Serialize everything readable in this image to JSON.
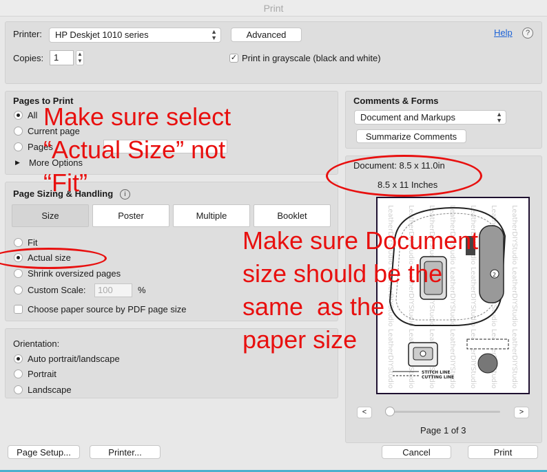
{
  "window": {
    "title": "Print"
  },
  "top": {
    "printer_label": "Printer:",
    "printer_value": "HP Deskjet 1010 series",
    "advanced_label": "Advanced",
    "help_link": "Help",
    "help_icon": "?",
    "copies_label": "Copies:",
    "copies_value": "1",
    "grayscale_label": "Print in grayscale (black and white)",
    "grayscale_checked": true
  },
  "pages_to_print": {
    "heading": "Pages to Print",
    "all": "All",
    "current_page": "Current page",
    "pages": "Pages",
    "more_options": "More Options"
  },
  "sizing": {
    "heading": "Page Sizing & Handling",
    "info_icon": "i",
    "tabs": [
      "Size",
      "Poster",
      "Multiple",
      "Booklet"
    ],
    "fit": "Fit",
    "actual_size": "Actual size",
    "shrink": "Shrink oversized pages",
    "custom_scale": "Custom Scale:",
    "custom_scale_value": "100",
    "percent": "%",
    "paper_source": "Choose paper source by PDF page size"
  },
  "orientation": {
    "heading": "Orientation:",
    "auto": "Auto portrait/landscape",
    "portrait": "Portrait",
    "landscape": "Landscape"
  },
  "comments": {
    "heading": "Comments & Forms",
    "select_value": "Document and Markups",
    "summarize_label": "Summarize Comments"
  },
  "preview": {
    "document_size": "Document: 8.5 x 11.0in",
    "paper_size": "8.5 x 11 Inches",
    "prev": "<",
    "next": ">",
    "page_indicator": "Page 1 of 3",
    "watermark": "LeatherDIYStudio",
    "stitch_label": "STITCH LINE",
    "cut_label": "CUTTING LINE"
  },
  "bottom": {
    "page_setup": "Page Setup...",
    "printer": "Printer...",
    "cancel": "Cancel",
    "print": "Print"
  },
  "annotations": {
    "note1": "Make sure select\n“Actual Size” not\n“Fit”",
    "note2": "Make sure Document\nsize should be the\nsame  as the\npaper size"
  },
  "colors": {
    "annotation": "#e8100f",
    "link": "#1b62d6"
  }
}
